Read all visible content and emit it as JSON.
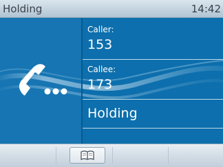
{
  "titlebar": {
    "title": "Holding",
    "clock": "14:42"
  },
  "call": {
    "caller_label": "Caller:",
    "caller_number": "153",
    "callee_label": "Callee:",
    "callee_number": "173",
    "status": "Holding",
    "icon": "handset-on-hold-icon"
  },
  "softkeys": [
    {
      "icon": "phonebook-icon"
    }
  ],
  "colors": {
    "main_background": "#0d6fad",
    "titlebar_background": "#c3d3df",
    "text_on_main": "#ffffff"
  }
}
